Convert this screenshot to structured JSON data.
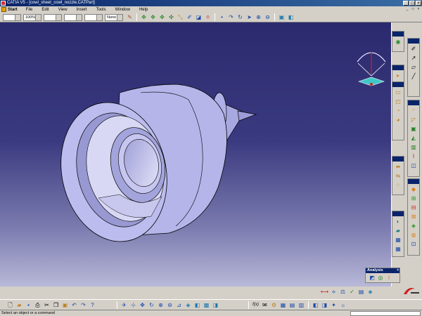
{
  "window": {
    "title": "CATIA V5 - [cowl_sheet_cowl_nozzle.CATPart]",
    "buttons": [
      "_",
      "□",
      "×"
    ]
  },
  "menu": {
    "start": "Start",
    "items": [
      "File",
      "Edit",
      "View",
      "Insert",
      "Tools",
      "Window",
      "Help"
    ],
    "mdi_buttons": [
      "_",
      "□",
      "×"
    ]
  },
  "toolbar_top": {
    "layer_combo": "",
    "zoom_combo": "100%",
    "linetype_combo": "",
    "lineweight_combo": "",
    "point_combo": "",
    "none_combo": "None"
  },
  "analysis": {
    "title": "Analysis",
    "close": "×"
  },
  "compass": {
    "label": "compass"
  },
  "status": {
    "message": "Select an object or a command",
    "command_value": ""
  },
  "colors": {
    "background_top": "#2c2a6e",
    "background_bottom": "#b8b8d8",
    "part_fill": "#b5b5ea",
    "ui_gray": "#d4d0c8",
    "title_blue": "#0a246a"
  },
  "icons": {
    "top": [
      "paint-icon",
      "pan-icon",
      "rotate-icon",
      "zoom-in-icon",
      "zoom-out-icon",
      "normal-view-icon",
      "multi-view-icon",
      "fit-all-icon",
      "shading-icon",
      "hide-show-icon",
      "swap-icon",
      "point-icon",
      "curve-icon",
      "surface-icon",
      "sketch-icon",
      "measure-icon"
    ],
    "bottom": [
      "new-icon",
      "open-icon",
      "save-icon",
      "print-icon",
      "cut-icon",
      "copy-icon",
      "paste-icon",
      "undo-icon",
      "redo-icon",
      "help-icon",
      "fly-icon",
      "fit-all-icon",
      "pan-icon",
      "rotate-icon",
      "zoom-in-icon",
      "zoom-out-icon",
      "normal-view-icon",
      "iso-view-icon",
      "shading-icon",
      "hide-show-icon",
      "swap-visible-icon"
    ]
  }
}
